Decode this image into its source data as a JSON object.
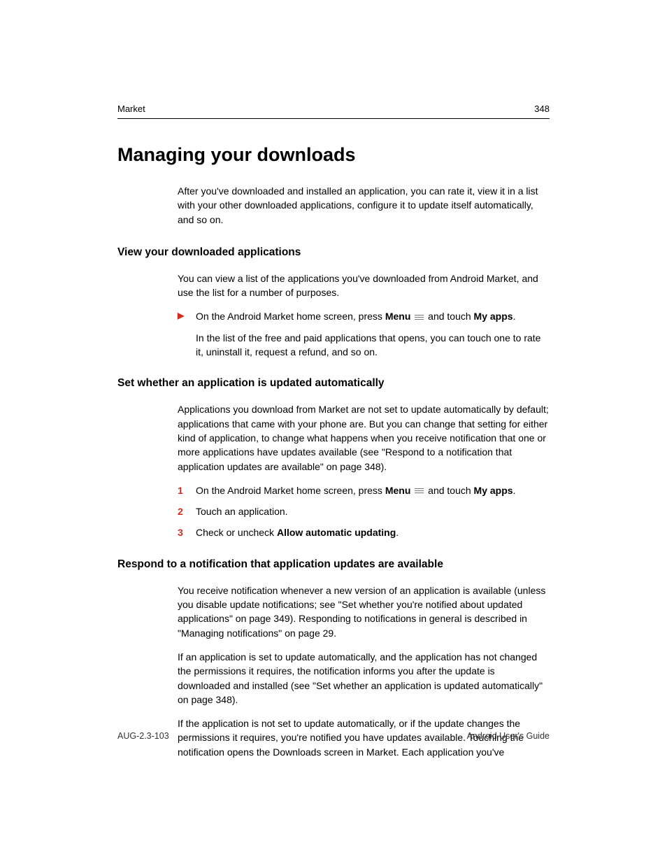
{
  "header": {
    "section": "Market",
    "page_number": "348"
  },
  "title": "Managing your downloads",
  "intro": "After you've downloaded and installed an application, you can rate it, view it in a list with your other downloaded applications, configure it to update itself automatically, and so on.",
  "s1": {
    "heading": "View your downloaded applications",
    "para": "You can view a list of the applications you've downloaded from Android Market, and use the list for a number of purposes.",
    "step_pre": "On the Android Market home screen, press ",
    "step_menu": "Menu",
    "step_mid": " and touch ",
    "step_myapps": "My apps",
    "step_post": ".",
    "note": "In the list of the free and paid applications that opens, you can touch one to rate it, uninstall it, request a refund, and so on."
  },
  "s2": {
    "heading": "Set whether an application is updated automatically",
    "para": "Applications you download from Market are not set to update automatically by default; applications that came with your phone are. But you can change that setting for either kind of application, to change what happens when you receive notification that one or more applications have updates available (see \"Respond to a notification that application updates are available\" on page 348).",
    "n1": "1",
    "n2": "2",
    "n3": "3",
    "step1_pre": "On the Android Market home screen, press ",
    "step1_menu": "Menu",
    "step1_mid": " and touch ",
    "step1_myapps": "My apps",
    "step1_post": ".",
    "step2": "Touch an application.",
    "step3_pre": "Check or uncheck ",
    "step3_bold": "Allow automatic updating",
    "step3_post": "."
  },
  "s3": {
    "heading": "Respond to a notification that application updates are available",
    "p1": "You receive notification whenever a new version of an application is available (unless you disable update notifications; see \"Set whether you're notified about updated applications\" on page 349). Responding to notifications in general is described in \"Managing notifications\" on page 29.",
    "p2": "If an application is set to update automatically, and the application has not changed the permissions it requires, the notification informs you after the update is downloaded and installed (see \"Set whether an application is updated automatically\" on page 348).",
    "p3": "If the application is not set to update automatically, or if the update changes the permissions it requires, you're notified you have updates available. Touching the notification opens the Downloads screen in Market. Each application you've"
  },
  "footer": {
    "left": "AUG-2.3-103",
    "right": "Android User's Guide"
  }
}
